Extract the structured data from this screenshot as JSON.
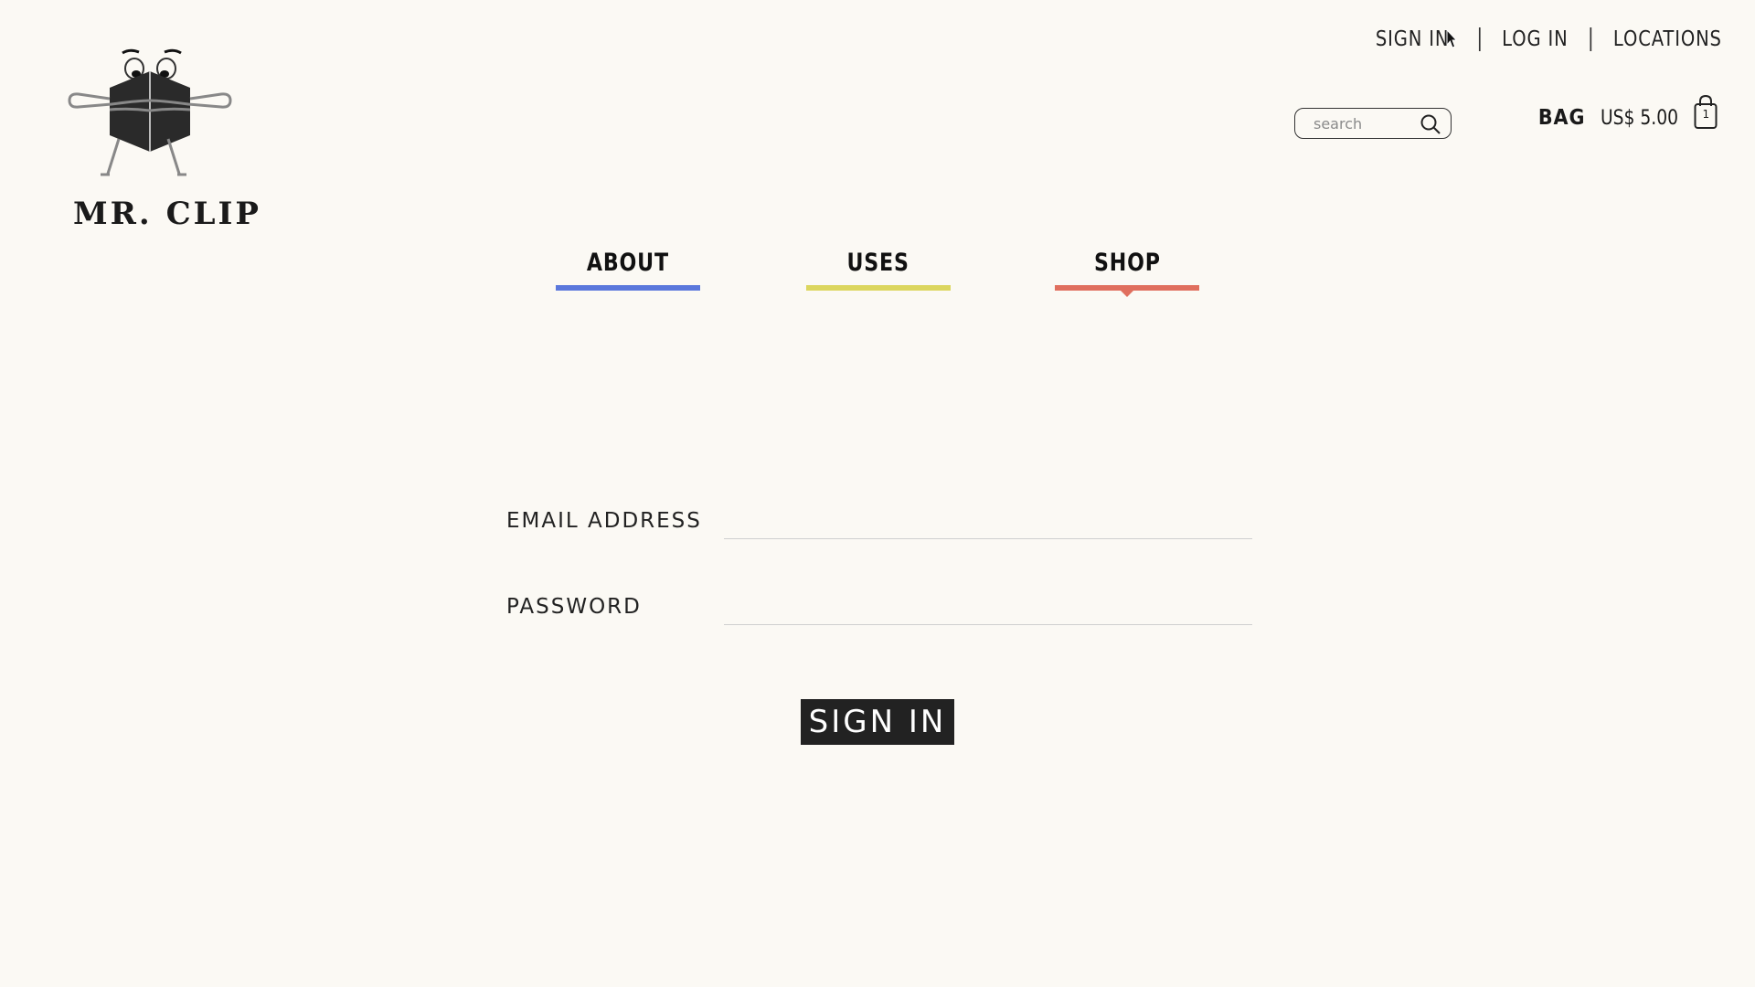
{
  "brand": {
    "name": "MR. CLIP"
  },
  "top_links": [
    {
      "label": "SIGN IN"
    },
    {
      "label": "LOG IN"
    },
    {
      "label": "LOCATIONS"
    }
  ],
  "search": {
    "placeholder": "search",
    "icon": "search-icon"
  },
  "bag": {
    "label": "BAG",
    "total": "US$ 5.00",
    "count": "1",
    "icon": "shopping-bag-icon"
  },
  "nav": [
    {
      "label": "ABOUT",
      "color": "#5b78dc"
    },
    {
      "label": "USES",
      "color": "#dcd65e"
    },
    {
      "label": "SHOP",
      "color": "#e06f5e",
      "active": true
    }
  ],
  "form": {
    "email_label": "EMAIL ADDRESS",
    "email_value": "",
    "password_label": "PASSWORD",
    "password_value": "",
    "submit_label": "SIGN IN"
  }
}
